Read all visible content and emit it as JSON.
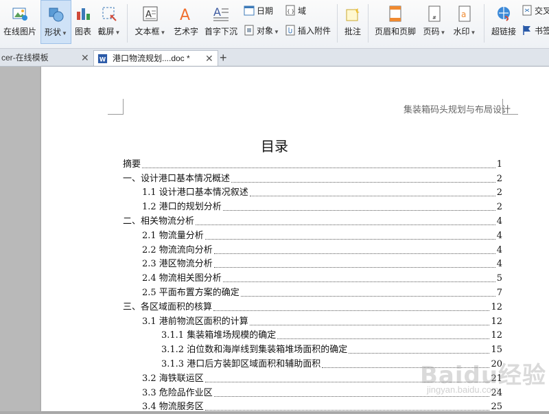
{
  "ribbon": {
    "online_image": "在线图片",
    "shape": "形状",
    "chart": "图表",
    "screenshot": "截屏",
    "textbox": "文本框",
    "wordart": "艺术字",
    "dropcap": "首字下沉",
    "date": "日期",
    "field": "域",
    "object": "对象",
    "insert_attachment": "插入附件",
    "comment": "批注",
    "header_footer": "页眉和页脚",
    "page_number": "页码",
    "watermark": "水印",
    "hyperlink": "超链接",
    "cross_ref": "交叉",
    "bookmark": "书签"
  },
  "tabs": [
    {
      "label": "cer-在线模板"
    },
    {
      "label": "港口物流规划....doc *"
    }
  ],
  "document": {
    "header_text": "集装箱码头规划与布局设计",
    "toc_title": "目录",
    "toc": [
      {
        "text": "摘要",
        "page": "1"
      },
      {
        "text": "一、设计港口基本情况概述",
        "page": "2"
      },
      {
        "text": "1.1 设计港口基本情况叙述",
        "page": "2"
      },
      {
        "text": "1.2 港口的规划分析",
        "page": "2"
      },
      {
        "text": "二、相关物流分析",
        "page": "4"
      },
      {
        "text": "2.1 物流量分析",
        "page": "4"
      },
      {
        "text": "2.2 物流流向分析",
        "page": "4"
      },
      {
        "text": "2.3 港区物流分析",
        "page": "4"
      },
      {
        "text": "2.4 物流相关图分析",
        "page": "5"
      },
      {
        "text": "2.5 平面布置方案的确定",
        "page": "7"
      },
      {
        "text": "三、各区域面积的核算",
        "page": "12"
      },
      {
        "text": "3.1 港前物流区面积的计算",
        "page": "12"
      },
      {
        "text": "3.1.1 集装箱堆场规模的确定",
        "page": "12"
      },
      {
        "text": "3.1.2 泊位数和海岸线到集装箱堆场面积的确定",
        "page": "15"
      },
      {
        "text": "3.1.3 港口后方装卸区域面积和辅助面积",
        "page": "20"
      },
      {
        "text": "3.2 海铁联运区",
        "page": "21"
      },
      {
        "text": "3.3 危险品作业区",
        "page": "24"
      },
      {
        "text": "3.4 物流服务区",
        "page": "25"
      }
    ]
  },
  "watermark": {
    "main": "Baidu经验",
    "sub": "jingyan.baidu.com"
  }
}
